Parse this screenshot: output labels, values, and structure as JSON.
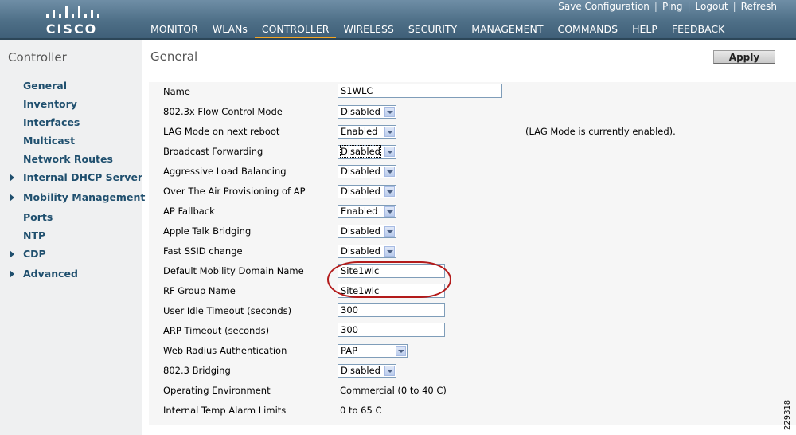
{
  "header": {
    "logo_text": "CISCO",
    "top_links": [
      "Save Configuration",
      "Ping",
      "Logout",
      "Refresh"
    ],
    "nav": [
      {
        "label": "MONITOR",
        "active": false
      },
      {
        "label": "WLANs",
        "active": false
      },
      {
        "label": "CONTROLLER",
        "active": true
      },
      {
        "label": "WIRELESS",
        "active": false
      },
      {
        "label": "SECURITY",
        "active": false
      },
      {
        "label": "MANAGEMENT",
        "active": false
      },
      {
        "label": "COMMANDS",
        "active": false
      },
      {
        "label": "HELP",
        "active": false
      },
      {
        "label": "FEEDBACK",
        "active": false
      }
    ]
  },
  "sidebar": {
    "title": "Controller",
    "items": [
      {
        "label": "General",
        "expandable": false
      },
      {
        "label": "Inventory",
        "expandable": false
      },
      {
        "label": "Interfaces",
        "expandable": false
      },
      {
        "label": "Multicast",
        "expandable": false
      },
      {
        "label": "Network Routes",
        "expandable": false
      },
      {
        "label": "Internal DHCP Server",
        "expandable": true
      },
      {
        "label": "Mobility Management",
        "expandable": true
      },
      {
        "label": "Ports",
        "expandable": false
      },
      {
        "label": "NTP",
        "expandable": false
      },
      {
        "label": "CDP",
        "expandable": true
      },
      {
        "label": "Advanced",
        "expandable": true
      }
    ]
  },
  "main": {
    "title": "General",
    "apply_label": "Apply",
    "lag_note": "(LAG Mode is currently enabled).",
    "rows": [
      {
        "label": "Name",
        "value": "S1WLC"
      },
      {
        "label": "802.3x Flow Control Mode",
        "value": "Disabled"
      },
      {
        "label": "LAG Mode on next reboot",
        "value": "Enabled"
      },
      {
        "label": "Broadcast Forwarding",
        "value": "Disabled"
      },
      {
        "label": "Aggressive Load Balancing",
        "value": "Disabled"
      },
      {
        "label": "Over The Air Provisioning of AP",
        "value": "Disabled"
      },
      {
        "label": "AP Fallback",
        "value": "Enabled"
      },
      {
        "label": "Apple Talk Bridging",
        "value": "Disabled"
      },
      {
        "label": "Fast SSID change",
        "value": "Disabled"
      },
      {
        "label": "Default Mobility Domain Name",
        "value": "Site1wlc"
      },
      {
        "label": "RF Group Name",
        "value": "Site1wlc"
      },
      {
        "label": "User Idle Timeout (seconds)",
        "value": "300"
      },
      {
        "label": "ARP Timeout (seconds)",
        "value": "300"
      },
      {
        "label": "Web Radius Authentication",
        "value": "PAP"
      },
      {
        "label": "802.3 Bridging",
        "value": "Disabled"
      },
      {
        "label": "Operating Environment",
        "value": "Commercial (0 to 40 C)"
      },
      {
        "label": "Internal Temp Alarm Limits",
        "value": "0 to 65 C"
      }
    ]
  },
  "figure_id": "229318",
  "colors": {
    "header": "#4e6f87",
    "active_tab": "#f5a623",
    "sidebar_link": "#1f4f6e",
    "highlight": "#b31b1b"
  }
}
